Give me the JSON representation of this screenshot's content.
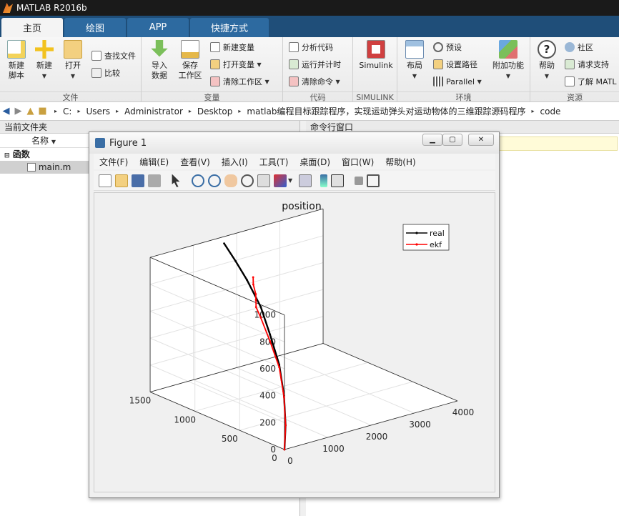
{
  "app": {
    "title": "MATLAB R2016b"
  },
  "tabs": [
    {
      "label": "主页",
      "active": true
    },
    {
      "label": "绘图",
      "active": false
    },
    {
      "label": "APP",
      "active": false
    },
    {
      "label": "快捷方式",
      "active": false
    }
  ],
  "ribbon": {
    "file": {
      "label": "文件",
      "new_script": "新建\n脚本",
      "new": "新建",
      "open": "打开",
      "find_files": "查找文件",
      "compare": "比较"
    },
    "variable": {
      "label": "变量",
      "import": "导入\n数据",
      "save_ws": "保存\n工作区",
      "new_var": "新建变量",
      "open_var": "打开变量",
      "clear_ws": "清除工作区"
    },
    "code": {
      "label": "代码",
      "analyze": "分析代码",
      "run_time": "运行并计时",
      "clear_cmds": "清除命令"
    },
    "simulink": {
      "label": "SIMULINK",
      "simulink": "Simulink"
    },
    "env": {
      "label": "环境",
      "layout": "布局",
      "prefs": "预设",
      "set_path": "设置路径",
      "parallel": "Parallel",
      "addons": "附加功能"
    },
    "resources": {
      "label": "资源",
      "help": "帮助",
      "community": "社区",
      "support": "请求支持",
      "learn": "了解 MATL"
    }
  },
  "address": {
    "crumbs": [
      "C:",
      "Users",
      "Administrator",
      "Desktop",
      "matlab编程目标跟踪程序，实现运动弹头对运动物体的三维跟踪源码程序",
      "code"
    ]
  },
  "current_folder": {
    "title": "当前文件夹",
    "col_name": "名称",
    "group": "函数",
    "file": "main.m"
  },
  "command_window": {
    "title": "命令行窗口"
  },
  "figure": {
    "title": "Figure 1",
    "menus": [
      "文件(F)",
      "编辑(E)",
      "查看(V)",
      "插入(I)",
      "工具(T)",
      "桌面(D)",
      "窗口(W)",
      "帮助(H)"
    ]
  },
  "chart_data": {
    "type": "line",
    "title": "position",
    "projection": "3d",
    "xlim": [
      0,
      4000
    ],
    "ylim": [
      0,
      1500
    ],
    "zlim": [
      0,
      1000
    ],
    "x_ticks": [
      "0",
      "1000",
      "2000",
      "3000",
      "4000"
    ],
    "y_ticks": [
      "0",
      "500",
      "1000",
      "1500"
    ],
    "z_ticks": [
      "0",
      "200",
      "400",
      "600",
      "800",
      "1000"
    ],
    "grid": true,
    "legend": "top-right",
    "series": [
      {
        "name": "real",
        "color": "#000000",
        "x": [
          0,
          150,
          300,
          500,
          700,
          900,
          1100,
          1250,
          1400
        ],
        "y": [
          0,
          60,
          150,
          300,
          500,
          700,
          950,
          1150,
          1350
        ],
        "z": [
          0,
          150,
          330,
          500,
          650,
          780,
          890,
          960,
          1020
        ]
      },
      {
        "name": "ekf",
        "color": "#ff0000",
        "x": [
          0,
          150,
          300,
          500,
          700,
          900,
          1000,
          1100,
          1200,
          1350,
          1450
        ],
        "y": [
          0,
          60,
          150,
          300,
          500,
          700,
          800,
          850,
          900,
          1000,
          1050
        ],
        "z": [
          0,
          150,
          320,
          480,
          600,
          700,
          740,
          770,
          790,
          820,
          850
        ]
      }
    ]
  }
}
